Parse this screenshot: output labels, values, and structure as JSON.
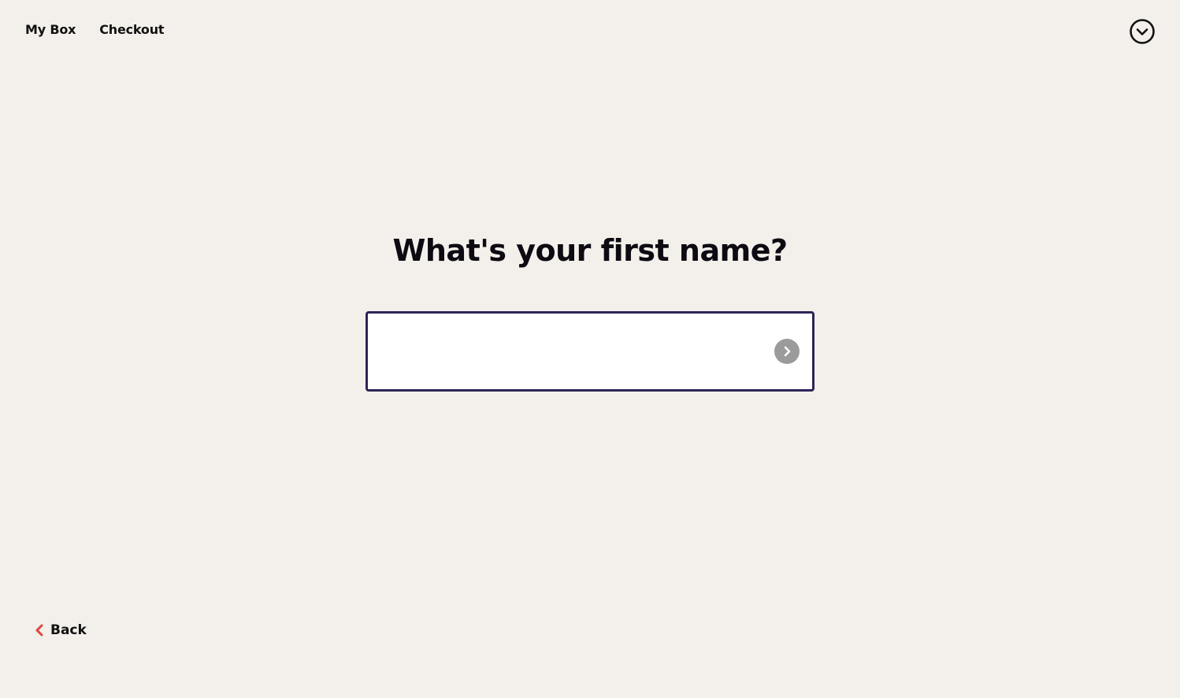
{
  "nav": {
    "items": [
      {
        "label": "My Box"
      },
      {
        "label": "Checkout"
      }
    ],
    "menu_icon": "chevron-down-circle-icon"
  },
  "main": {
    "question": "What's your first name?",
    "input": {
      "value": "",
      "placeholder": ""
    },
    "submit_icon": "chevron-right-icon"
  },
  "footer": {
    "back_label": "Back",
    "back_icon": "chevron-left-icon"
  },
  "colors": {
    "background": "#f3efeb",
    "input_border": "#2e2457",
    "submit_bg": "#9b9b9b",
    "back_chevron": "#e0463f"
  }
}
